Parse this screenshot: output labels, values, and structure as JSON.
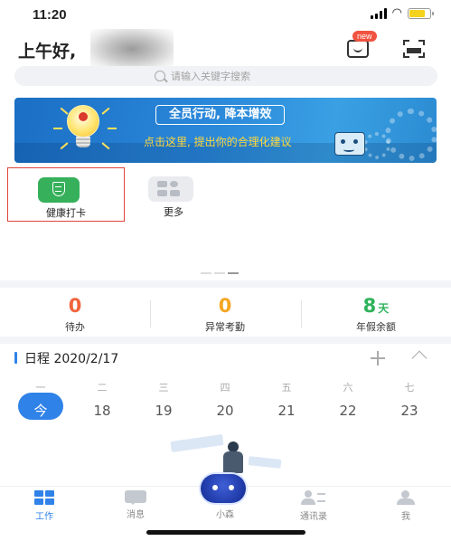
{
  "status_bar": {
    "time": "11:20"
  },
  "header": {
    "greeting": "上午好,",
    "new_badge": "new",
    "search_placeholder": "请输入关键字搜索"
  },
  "banner": {
    "title": "全员行动, 降本增效",
    "subtitle": "点击这里, 提出你的合理化建议"
  },
  "apps": [
    {
      "label": "健康打卡",
      "icon": "health-check-in-icon",
      "color": "#36b05b"
    },
    {
      "label": "更多",
      "icon": "more-apps-icon",
      "color": "#e9ebef"
    }
  ],
  "stats": [
    {
      "value": "0",
      "unit": "",
      "label": "待办",
      "color": "#f0643c"
    },
    {
      "value": "0",
      "unit": "",
      "label": "异常考勤",
      "color": "#f5a623"
    },
    {
      "value": "8",
      "unit": "天",
      "label": "年假余额",
      "color": "#2fb25a"
    }
  ],
  "schedule": {
    "title": "日程 2020/2/17",
    "weekdays": [
      "一",
      "二",
      "三",
      "四",
      "五",
      "六",
      "七"
    ],
    "dates": [
      "今",
      "18",
      "19",
      "20",
      "21",
      "22",
      "23"
    ]
  },
  "tabs": [
    {
      "label": "工作",
      "icon": "work-grid-icon",
      "active": true
    },
    {
      "label": "消息",
      "icon": "message-icon",
      "active": false
    },
    {
      "label": "小森",
      "icon": "robot-assistant-icon",
      "active": false
    },
    {
      "label": "通讯录",
      "icon": "contacts-icon",
      "active": false
    },
    {
      "label": "我",
      "icon": "me-icon",
      "active": false
    }
  ],
  "colors": {
    "accent": "#2f82e8",
    "selection_border": "#e0453b",
    "badge": "#f0533f"
  }
}
